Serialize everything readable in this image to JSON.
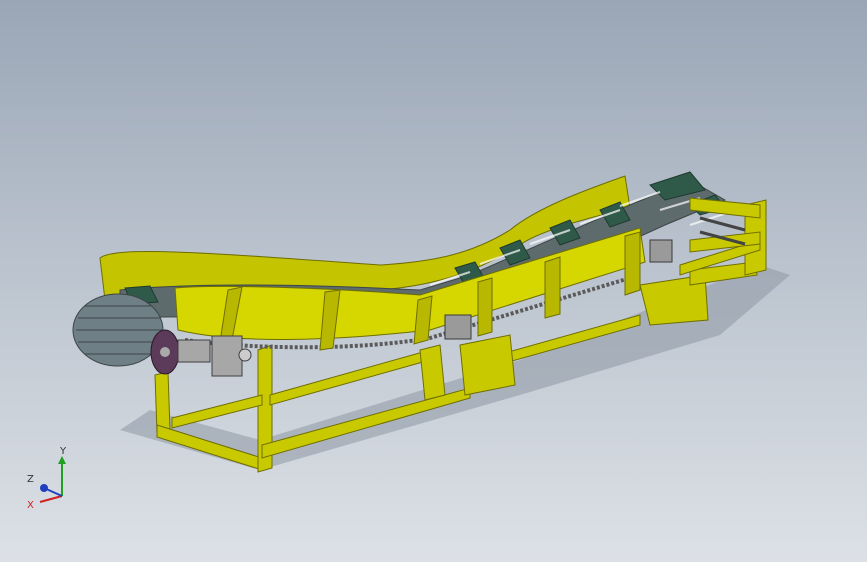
{
  "viewport": {
    "background_top": "#9aa6b6",
    "background_bottom": "#dde1e6"
  },
  "model": {
    "frame_color": "#cccc00",
    "frame_dark": "#8f8f00",
    "belt_color": "#2f5a4a",
    "roller_color": "#6f7f86",
    "chain_color": "#5a5a5a"
  },
  "triad": {
    "x_label": "X",
    "y_label": "Y",
    "z_label": "Z",
    "x_color": "#d02020",
    "y_color": "#20a020",
    "z_color": "#2040c0"
  }
}
